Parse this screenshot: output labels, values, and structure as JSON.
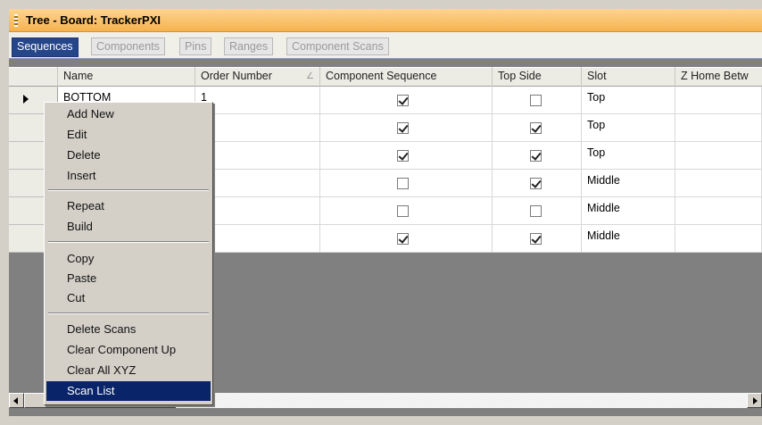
{
  "window": {
    "title": "Tree - Board: TrackerPXI"
  },
  "tabs": [
    {
      "label": "Sequences",
      "active": true
    },
    {
      "label": "Components",
      "active": false
    },
    {
      "label": "Pins",
      "active": false
    },
    {
      "label": "Ranges",
      "active": false
    },
    {
      "label": "Component Scans",
      "active": false
    }
  ],
  "grid": {
    "columns": [
      "Name",
      "Order Number",
      "Component Sequence",
      "Top Side",
      "Slot",
      "Z Home Betw"
    ],
    "sort_glyph": "∠",
    "rows": [
      {
        "name": "BOTTOM",
        "order": "1",
        "component_sequence": true,
        "top_side": false,
        "slot": "Top"
      },
      {
        "name": "",
        "order": "",
        "component_sequence": true,
        "top_side": true,
        "slot": "Top"
      },
      {
        "name": "",
        "order": "",
        "component_sequence": true,
        "top_side": true,
        "slot": "Top"
      },
      {
        "name": "",
        "order": "",
        "component_sequence": false,
        "top_side": true,
        "slot": "Middle"
      },
      {
        "name": "",
        "order": "",
        "component_sequence": false,
        "top_side": false,
        "slot": "Middle"
      },
      {
        "name": "",
        "order": "",
        "component_sequence": true,
        "top_side": true,
        "slot": "Middle"
      }
    ]
  },
  "context_menu": {
    "items": [
      "Add New",
      "Edit",
      "Delete",
      "Insert",
      "Repeat",
      "Build",
      "Copy",
      "Paste",
      "Cut",
      "Delete Scans",
      "Clear Component Up",
      "Clear All XYZ",
      "Scan List"
    ],
    "selected": "Scan List"
  },
  "colors": {
    "title_bar": "#f6b24e",
    "active_tab": "#26468a",
    "menu_highlight": "#0a246a"
  }
}
